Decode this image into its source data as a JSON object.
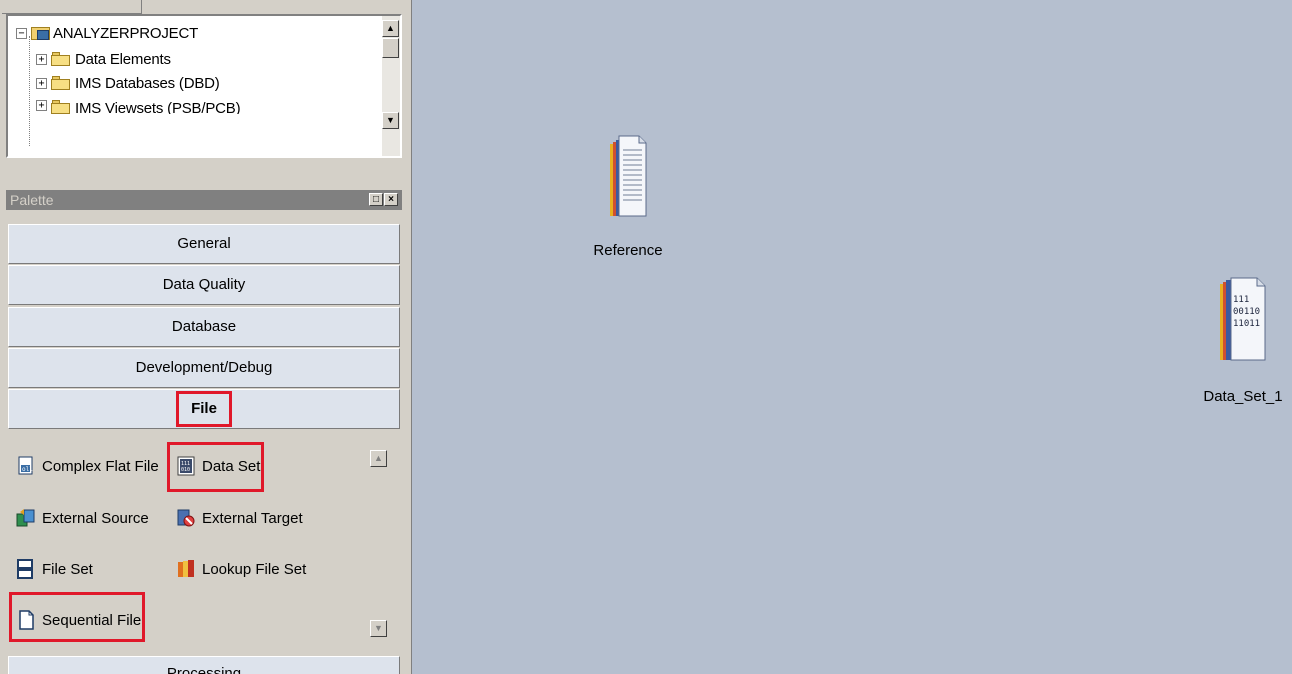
{
  "repository_tree": {
    "root": {
      "label": "ANALYZERPROJECT",
      "expander": "−"
    },
    "children": [
      {
        "label": "Data Elements",
        "expander": "+"
      },
      {
        "label": "IMS Databases (DBD)",
        "expander": "+"
      },
      {
        "label": "IMS Viewsets (PSB/PCB)",
        "expander": "+"
      }
    ]
  },
  "palette": {
    "title": "Palette",
    "categories": [
      {
        "label": "General"
      },
      {
        "label": "Data Quality"
      },
      {
        "label": "Database"
      },
      {
        "label": "Development/Debug"
      },
      {
        "label": "File"
      },
      {
        "label": "Processing"
      }
    ],
    "file_items": [
      {
        "label": "Complex Flat File",
        "icon": "complex-flat-file-icon"
      },
      {
        "label": "Data Set",
        "icon": "data-set-icon"
      },
      {
        "label": "External Source",
        "icon": "external-source-icon"
      },
      {
        "label": "External Target",
        "icon": "external-target-icon"
      },
      {
        "label": "File Set",
        "icon": "file-set-icon"
      },
      {
        "label": "Lookup File Set",
        "icon": "lookup-file-set-icon"
      },
      {
        "label": "Sequential File",
        "icon": "sequential-file-icon"
      }
    ]
  },
  "canvas": {
    "stages": [
      {
        "label": "Reference",
        "icon": "sequential-file-stage-icon"
      },
      {
        "label": "Data_Set_1",
        "icon": "data-set-stage-icon",
        "icon_text": [
          "111",
          "00110",
          "11011"
        ]
      }
    ]
  },
  "colors": {
    "canvas_bg": "#b5bfcf",
    "panel_bg": "#d4d0c8",
    "category_bg": "#dde3ec",
    "highlight_red": "#e0182a"
  }
}
